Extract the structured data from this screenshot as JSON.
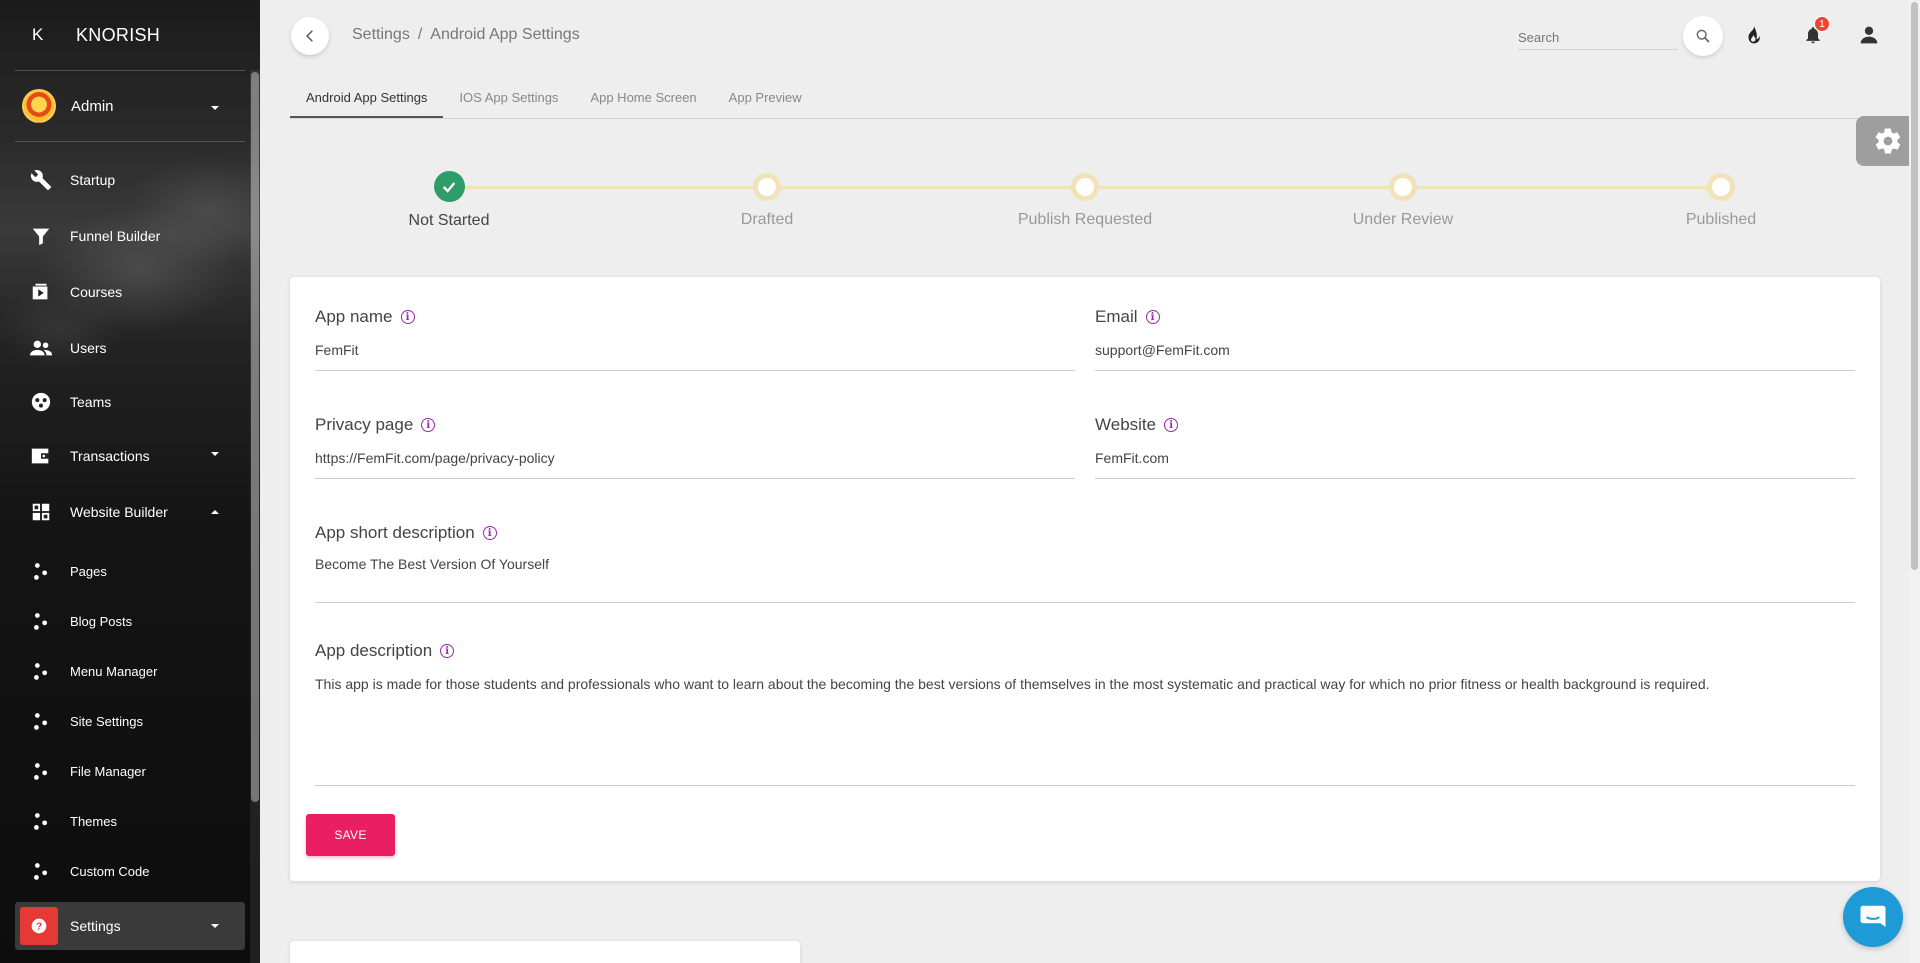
{
  "sidebar": {
    "brand_mini": "K",
    "brand_name": "KNORISH",
    "user_name": "Admin",
    "items": [
      {
        "label": "Startup"
      },
      {
        "label": "Funnel Builder"
      },
      {
        "label": "Courses"
      },
      {
        "label": "Users"
      },
      {
        "label": "Teams"
      },
      {
        "label": "Transactions"
      },
      {
        "label": "Website Builder"
      }
    ],
    "sub_items": [
      {
        "label": "Pages"
      },
      {
        "label": "Blog Posts"
      },
      {
        "label": "Menu Manager"
      },
      {
        "label": "Site Settings"
      },
      {
        "label": "File Manager"
      },
      {
        "label": "Themes"
      },
      {
        "label": "Custom Code"
      }
    ],
    "active_item": {
      "label": "Settings"
    }
  },
  "header": {
    "breadcrumb_root": "Settings",
    "breadcrumb_sep": "/",
    "breadcrumb_current": "Android App Settings",
    "search_placeholder": "Search",
    "notification_count": "1"
  },
  "tabs": [
    {
      "label": "Android App Settings",
      "active": true
    },
    {
      "label": "IOS App Settings",
      "active": false
    },
    {
      "label": "App Home Screen",
      "active": false
    },
    {
      "label": "App Preview",
      "active": false
    }
  ],
  "stepper": {
    "steps": [
      {
        "label": "Not Started",
        "done": true
      },
      {
        "label": "Drafted",
        "done": false
      },
      {
        "label": "Publish Requested",
        "done": false
      },
      {
        "label": "Under Review",
        "done": false
      },
      {
        "label": "Published",
        "done": false
      }
    ]
  },
  "form": {
    "app_name": {
      "label": "App name",
      "value": "FemFit"
    },
    "email": {
      "label": "Email",
      "value": "support@FemFit.com"
    },
    "privacy_page": {
      "label": "Privacy page",
      "value": "https://FemFit.com/page/privacy-policy"
    },
    "website": {
      "label": "Website",
      "value": "FemFit.com"
    },
    "short_description": {
      "label": "App short description",
      "value": "Become The Best Version Of Yourself"
    },
    "description": {
      "label": "App description",
      "value": "This app is made for those students and professionals who want to learn about the becoming the best versions of themselves in the most systematic and practical way for which no prior fitness or health background is required."
    },
    "save_label": "SAVE",
    "info_glyph": "i"
  },
  "colors": {
    "accent": "#e91e63",
    "done": "#2e9d6a",
    "step_pending": "#f1e2b8",
    "info": "#9c27b0",
    "badge": "#f44336",
    "chat": "#1e9bd7"
  }
}
